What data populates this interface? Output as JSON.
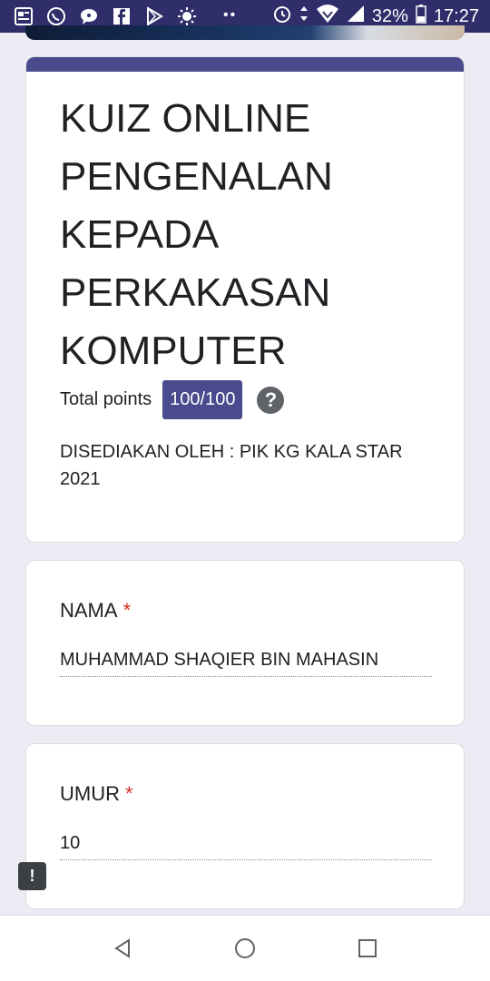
{
  "status_bar": {
    "icons_left": [
      "news-icon",
      "whatsapp-icon",
      "chat-icon",
      "facebook-icon",
      "play-store-icon",
      "brightness-icon"
    ],
    "dots": "••",
    "battery_percent": "32%",
    "time": "17:27"
  },
  "form": {
    "title": "KUIZ ONLINE PENGENALAN KEPADA PERKAKASAN KOMPUTER",
    "total_points_label": "Total points",
    "score": "100/100",
    "help_glyph": "?",
    "description": "DISEDIAKAN OLEH : PIK KG KALA STAR 2021"
  },
  "questions": [
    {
      "label": "NAMA",
      "required_mark": "*",
      "answer": "MUHAMMAD SHAQIER BIN MAHASIN"
    },
    {
      "label": "UMUR",
      "required_mark": "*",
      "answer": "10"
    }
  ],
  "feedback_glyph": "!",
  "colors": {
    "accent": "#4a4a8e",
    "status_bar": "#2f2d6a",
    "required": "#d93025",
    "background": "#ececf4"
  }
}
